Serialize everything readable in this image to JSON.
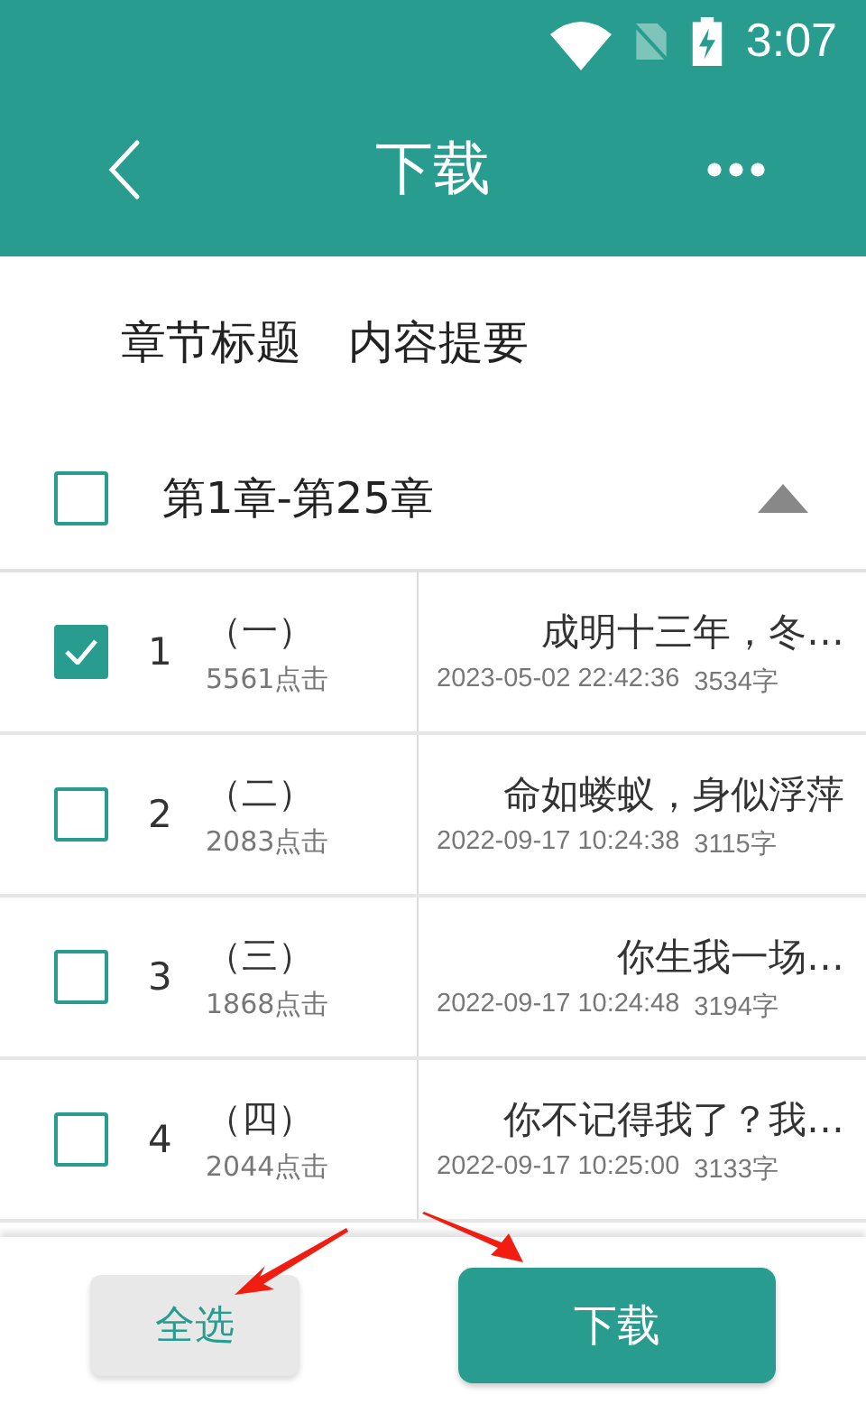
{
  "status_bar": {
    "time": "3:07"
  },
  "toolbar": {
    "title": "下载"
  },
  "tabs": [
    {
      "label": "章节标题"
    },
    {
      "label": "内容提要"
    }
  ],
  "group": {
    "label": "第1章-第25章",
    "checked": false,
    "expanded": true
  },
  "chapters": [
    {
      "number": "1",
      "title": "（一）",
      "clicks": "5561点击",
      "summary": "成明十三年，冬…",
      "date": "2023-05-02 22:42:36",
      "words": "3534字",
      "checked": true
    },
    {
      "number": "2",
      "title": "（二）",
      "clicks": "2083点击",
      "summary": "命如蝼蚁，身似浮萍",
      "date": "2022-09-17 10:24:38",
      "words": "3115字",
      "checked": false
    },
    {
      "number": "3",
      "title": "（三）",
      "clicks": "1868点击",
      "summary": "你生我一场…",
      "date": "2022-09-17 10:24:48",
      "words": "3194字",
      "checked": false
    },
    {
      "number": "4",
      "title": "（四）",
      "clicks": "2044点击",
      "summary": "你不记得我了？我…",
      "date": "2022-09-17 10:25:00",
      "words": "3133字",
      "checked": false
    }
  ],
  "buttons": {
    "select_all": "全选",
    "download": "下载"
  }
}
